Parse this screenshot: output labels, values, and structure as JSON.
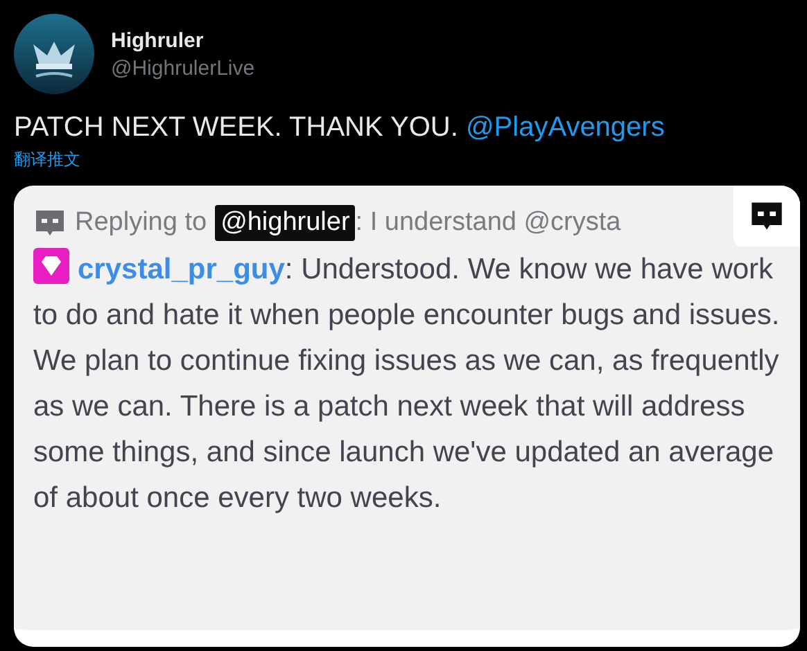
{
  "author": {
    "name": "Highruler",
    "handle": "@HighrulerLive"
  },
  "tweet": {
    "text": "PATCH NEXT WEEK. THANK YOU.",
    "mention": "@PlayAvengers"
  },
  "translate_link": "翻译推文",
  "image": {
    "reply": {
      "label": "Replying to",
      "mention": "@highruler",
      "text": ": I understand @crysta"
    },
    "message": {
      "username": "crystal_pr_guy",
      "text": ": Understood. We know we have work to do and hate it when people encounter bugs and issues. We plan to continue fixing issues as we can, as frequently as we can. There is a patch next week that will address some things, and since launch we've updated an average of about once every two weeks."
    }
  }
}
